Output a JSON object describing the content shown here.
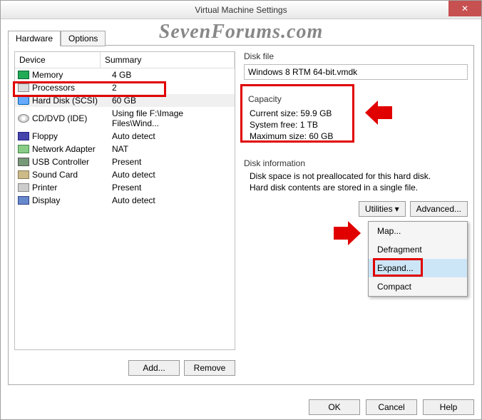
{
  "window": {
    "title": "Virtual Machine Settings",
    "close_label": "✕"
  },
  "watermark": "SevenForums.com",
  "tabs": {
    "hardware": "Hardware",
    "options": "Options"
  },
  "device_list": {
    "headers": {
      "device": "Device",
      "summary": "Summary"
    },
    "items": [
      {
        "name": "Memory",
        "summary": "4 GB",
        "icon": "ico-mem"
      },
      {
        "name": "Processors",
        "summary": "2",
        "icon": "ico-cpu"
      },
      {
        "name": "Hard Disk (SCSI)",
        "summary": "60 GB",
        "icon": "ico-hdd",
        "selected": true
      },
      {
        "name": "CD/DVD (IDE)",
        "summary": "Using file F:\\Image Files\\Wind...",
        "icon": "ico-cd"
      },
      {
        "name": "Floppy",
        "summary": "Auto detect",
        "icon": "ico-floppy"
      },
      {
        "name": "Network Adapter",
        "summary": "NAT",
        "icon": "ico-net"
      },
      {
        "name": "USB Controller",
        "summary": "Present",
        "icon": "ico-usb"
      },
      {
        "name": "Sound Card",
        "summary": "Auto detect",
        "icon": "ico-snd"
      },
      {
        "name": "Printer",
        "summary": "Present",
        "icon": "ico-prn"
      },
      {
        "name": "Display",
        "summary": "Auto detect",
        "icon": "ico-disp"
      }
    ]
  },
  "left_buttons": {
    "add": "Add...",
    "remove": "Remove"
  },
  "disk_file": {
    "label": "Disk file",
    "value": "Windows 8 RTM 64-bit.vmdk"
  },
  "capacity": {
    "label": "Capacity",
    "current_label": "Current size:",
    "current_value": "59.9 GB",
    "free_label": "System free:",
    "free_value": "1 TB",
    "max_label": "Maximum size:",
    "max_value": "60 GB"
  },
  "disk_info": {
    "label": "Disk information",
    "line1": "Disk space is not preallocated for this hard disk.",
    "line2": "Hard disk contents are stored in a single file."
  },
  "utilities": {
    "btn": "Utilities",
    "advanced": "Advanced...",
    "menu": {
      "map": "Map...",
      "defrag": "Defragment",
      "expand": "Expand...",
      "compact": "Compact"
    }
  },
  "footer": {
    "ok": "OK",
    "cancel": "Cancel",
    "help": "Help"
  }
}
